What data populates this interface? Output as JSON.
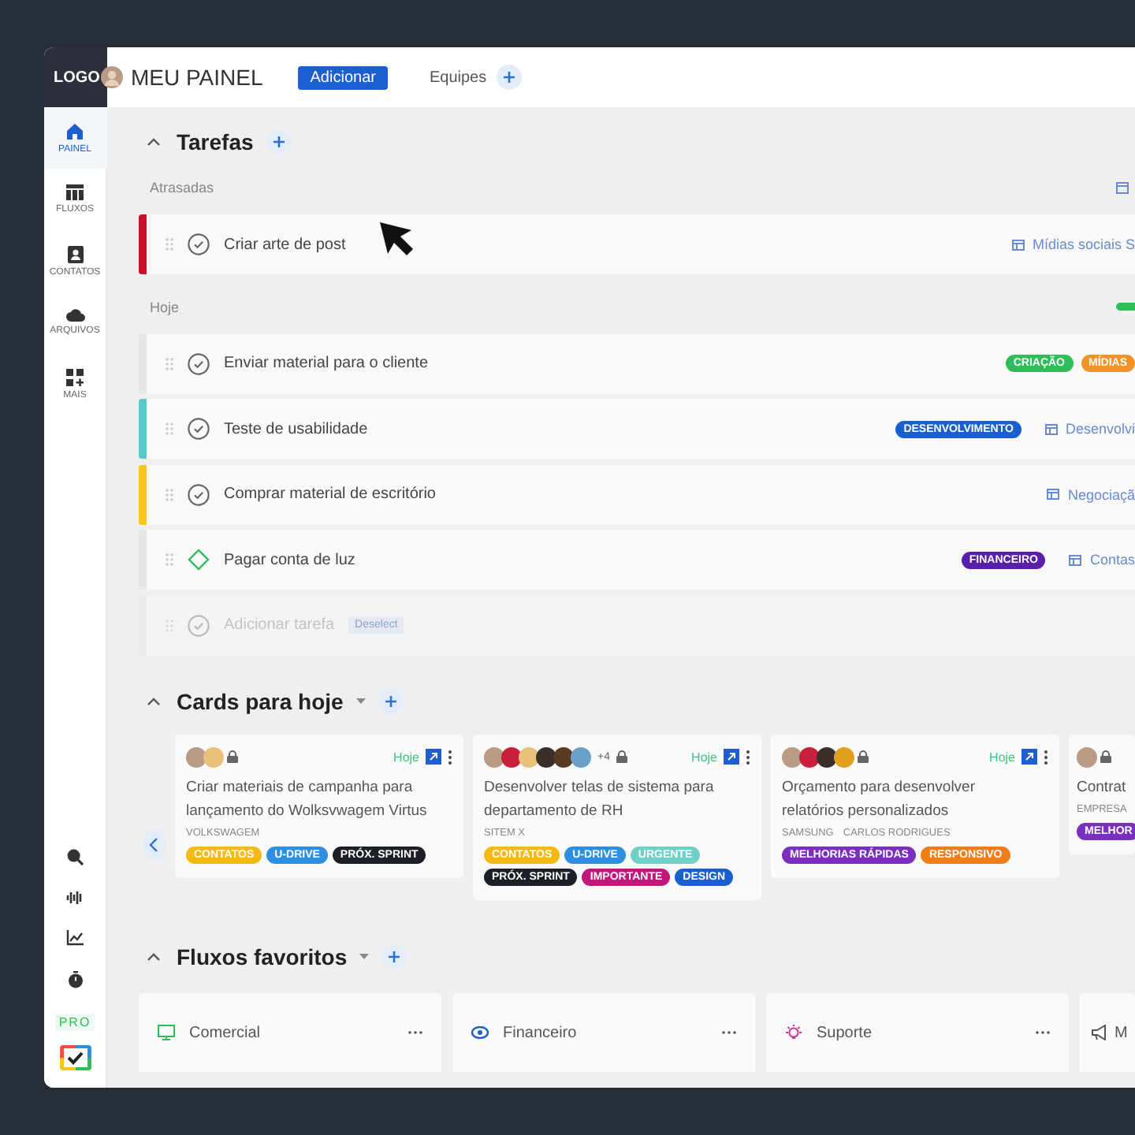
{
  "header": {
    "logo": "LOGO",
    "title": "MEU PAINEL",
    "add_button": "Adicionar",
    "teams_label": "Equipes"
  },
  "sidebar": {
    "items": [
      {
        "label": "PAINEL",
        "selected": true
      },
      {
        "label": "FLUXOS",
        "selected": false
      },
      {
        "label": "CONTATOS",
        "selected": false
      },
      {
        "label": "ARQUIVOS",
        "selected": false
      },
      {
        "label": "MAIS",
        "selected": false
      }
    ],
    "pro_badge": "PRO"
  },
  "tasks": {
    "title": "Tarefas",
    "groups": [
      {
        "label": "Atrasadas",
        "tasks": [
          {
            "kind": "task",
            "title": "Criar arte de post",
            "color": "#c8102e",
            "board": "Mídias sociais S"
          }
        ]
      },
      {
        "label": "Hoje",
        "tasks": [
          {
            "kind": "task",
            "title": "Enviar material para o cliente",
            "tags": [
              {
                "label": "CRIAÇÃO",
                "color": "#2ebd59"
              },
              {
                "label": "MÍDIAS",
                "color": "#f0932b"
              }
            ]
          },
          {
            "kind": "task",
            "title": "Teste de usabilidade",
            "color": "#5cc9c9",
            "tags": [
              {
                "label": "DESENVOLVIMENTO",
                "color": "#1a5fd0"
              }
            ],
            "board": "Desenvolvi"
          },
          {
            "kind": "task",
            "title": "Comprar material de escritório",
            "color": "#f5c518",
            "board": "Negociaçã"
          },
          {
            "kind": "milestone",
            "title": "Pagar conta de luz",
            "tags": [
              {
                "label": "FINANCEIRO",
                "color": "#5a1fa8"
              }
            ],
            "board": "Contas"
          }
        ]
      }
    ],
    "add_placeholder": "Adicionar tarefa",
    "add_hint": "Deselect"
  },
  "cards": {
    "title": "Cards para hoje",
    "items": [
      {
        "avatars": [
          {
            "color": "#b89a85"
          },
          {
            "color": "#e8c27a"
          }
        ],
        "due": "Hoje",
        "title": "Criar materiais de campanha para lançamento do Wolksvwagem Virtus",
        "company": "VOLKSWAGEM",
        "tags": [
          {
            "label": "CONTATOS",
            "color": "#f5b914"
          },
          {
            "label": "U-DRIVE",
            "color": "#2e8fe0"
          },
          {
            "label": "PRÓX. SPRINT",
            "color": "#1c1f26"
          }
        ]
      },
      {
        "avatars": [
          {
            "color": "#b89a85"
          },
          {
            "color": "#c8203a"
          },
          {
            "color": "#e8c27a"
          },
          {
            "color": "#3a2f2a"
          },
          {
            "color": "#5a3a20"
          },
          {
            "color": "#6aa0c8"
          }
        ],
        "extra": "+4",
        "due": "Hoje",
        "title": "Desenvolver telas de sistema para departamento de RH",
        "company": "SITEM X",
        "tags": [
          {
            "label": "CONTATOS",
            "color": "#f5b914"
          },
          {
            "label": "U-DRIVE",
            "color": "#2e8fe0"
          },
          {
            "label": "URGENTE",
            "color": "#6fd0c8"
          },
          {
            "label": "PRÓX. SPRINT",
            "color": "#1c1f26"
          },
          {
            "label": "IMPORTANTE",
            "color": "#c2177a"
          },
          {
            "label": "DESIGN",
            "color": "#1a5fd0"
          }
        ]
      },
      {
        "avatars": [
          {
            "color": "#b89a85"
          },
          {
            "color": "#c8203a"
          },
          {
            "color": "#3a2f2a"
          },
          {
            "color": "#e0a020"
          }
        ],
        "due": "Hoje",
        "title": "Orçamento para desenvolver relatórios personalizados",
        "company": "SAMSUNG",
        "contact": "CARLOS RODRIGUES",
        "tags": [
          {
            "label": "MELHORIAS RÁPIDAS",
            "color": "#7b2fbf"
          },
          {
            "label": "RESPONSIVO",
            "color": "#ef7d1a"
          }
        ]
      },
      {
        "avatars": [
          {
            "color": "#b89a85"
          }
        ],
        "title": "Contrat",
        "company": "EMPRESA",
        "tags": [
          {
            "label": "MELHOR",
            "color": "#7b2fbf"
          }
        ]
      }
    ]
  },
  "flows": {
    "title": "Fluxos favoritos",
    "items": [
      {
        "label": "Comercial",
        "color": "#2ebd59"
      },
      {
        "label": "Financeiro",
        "color": "#1a5fd0"
      },
      {
        "label": "Suporte",
        "color": "#d6338a"
      },
      {
        "label": "M",
        "color": "#555555"
      }
    ]
  }
}
